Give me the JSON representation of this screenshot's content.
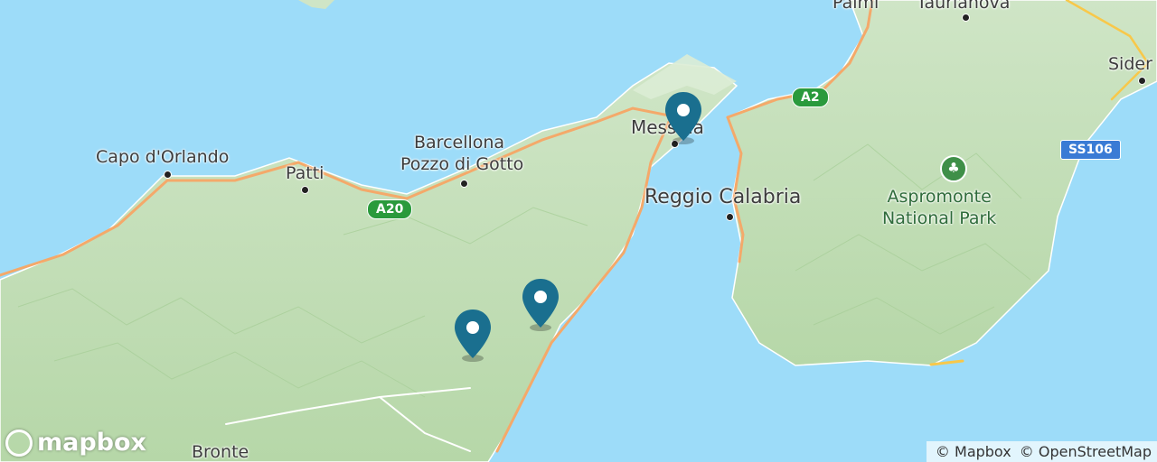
{
  "map": {
    "places": {
      "capo_dorlando": "Capo d'Orlando",
      "patti": "Patti",
      "barcellona": "Barcellona",
      "pozzo": "Pozzo di Gotto",
      "messina": "Messina",
      "reggio": "Reggio Calabria",
      "bronte": "Bronte",
      "patmi": "Palmi",
      "taurianova": "Taurianova",
      "siderno": "Sider"
    },
    "park": {
      "line1": "Aspromonte",
      "line2": "National Park"
    },
    "roads": {
      "a20": "A20",
      "a2": "A2",
      "ss106": "SS106"
    },
    "markers": [
      "messina-marker",
      "marker-east",
      "marker-west"
    ],
    "colors": {
      "sea": "#9ddcf9",
      "land": "#d6ead0",
      "forest": "#b8d9ac",
      "road": "#f4a96a",
      "marker": "#1a6f8f"
    }
  },
  "branding": {
    "logo": "mapbox"
  },
  "attribution": {
    "mapbox": "© Mapbox",
    "osm": "© OpenStreetMap"
  }
}
